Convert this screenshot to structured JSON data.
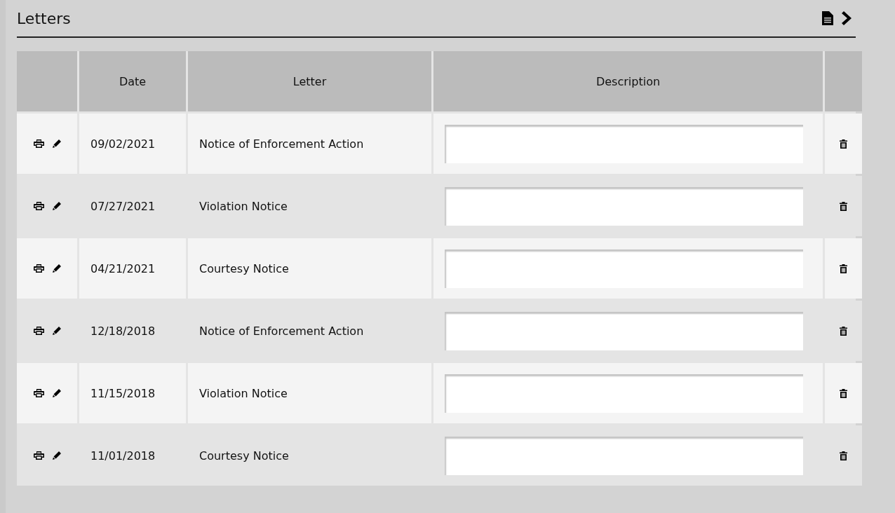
{
  "panel": {
    "title": "Letters"
  },
  "table": {
    "columns": [
      "Date",
      "Letter",
      "Description"
    ],
    "rows": [
      {
        "date": "09/02/2021",
        "letter": "Notice of Enforcement Action"
      },
      {
        "date": "07/27/2021",
        "letter": "Violation Notice"
      },
      {
        "date": "04/21/2021",
        "letter": "Courtesy Notice"
      },
      {
        "date": "12/18/2018",
        "letter": "Notice of Enforcement Action"
      },
      {
        "date": "11/15/2018",
        "letter": "Violation Notice"
      },
      {
        "date": "11/01/2018",
        "letter": "Courtesy Notice"
      }
    ]
  }
}
